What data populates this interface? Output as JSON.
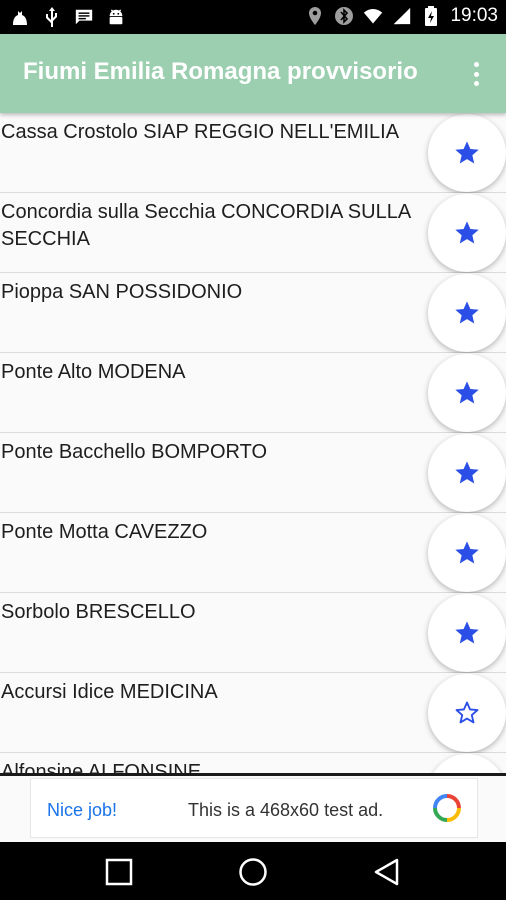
{
  "status_bar": {
    "time": "19:03",
    "left_icons": [
      "cat-notification-icon",
      "usb-icon",
      "message-icon",
      "android-icon"
    ],
    "right_icons": [
      "location-icon",
      "bluetooth-icon",
      "wifi-icon",
      "signal-icon",
      "battery-icon"
    ]
  },
  "app_bar": {
    "title": "Fiumi Emilia Romagna provvisorio",
    "overflow_icon": "more-vert-icon",
    "background": "#9bcfb0"
  },
  "stations": [
    {
      "name": "Cassa Crostolo SIAP REGGIO NELL'EMILIA",
      "favorite": true
    },
    {
      "name": "Concordia sulla Secchia CONCORDIA SULLA SECCHIA",
      "favorite": true
    },
    {
      "name": "Pioppa SAN POSSIDONIO",
      "favorite": true
    },
    {
      "name": "Ponte Alto MODENA",
      "favorite": true
    },
    {
      "name": "Ponte Bacchello BOMPORTO",
      "favorite": true
    },
    {
      "name": "Ponte Motta CAVEZZO",
      "favorite": true
    },
    {
      "name": "Sorbolo BRESCELLO",
      "favorite": true
    },
    {
      "name": "Accursi Idice MEDICINA",
      "favorite": false
    },
    {
      "name": "Alfonsine ALFONSINE",
      "favorite": false
    }
  ],
  "ad": {
    "nice_job": "Nice job!",
    "text": "This is a 468x60 test ad."
  },
  "nav": [
    "recents-button",
    "home-button",
    "back-button"
  ],
  "colors": {
    "star": "#2b4fe6",
    "app_bar": "#9bcfb0"
  }
}
